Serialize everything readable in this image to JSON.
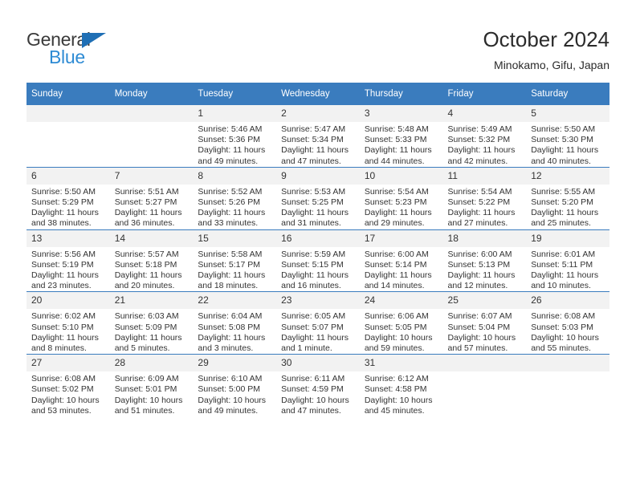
{
  "brand": {
    "name_part1": "General",
    "name_part2": "Blue",
    "triangle_color": "#1f6fb5",
    "blue_text_color": "#2e8bd4"
  },
  "header": {
    "title": "October 2024",
    "subtitle": "Minokamo, Gifu, Japan",
    "accent_color": "#3a7cbe"
  },
  "weekdays": [
    "Sunday",
    "Monday",
    "Tuesday",
    "Wednesday",
    "Thursday",
    "Friday",
    "Saturday"
  ],
  "weeks": [
    [
      {
        "day": "",
        "empty": true
      },
      {
        "day": "",
        "empty": true
      },
      {
        "day": "1",
        "sunrise": "Sunrise: 5:46 AM",
        "sunset": "Sunset: 5:36 PM",
        "daylight": "Daylight: 11 hours and 49 minutes."
      },
      {
        "day": "2",
        "sunrise": "Sunrise: 5:47 AM",
        "sunset": "Sunset: 5:34 PM",
        "daylight": "Daylight: 11 hours and 47 minutes."
      },
      {
        "day": "3",
        "sunrise": "Sunrise: 5:48 AM",
        "sunset": "Sunset: 5:33 PM",
        "daylight": "Daylight: 11 hours and 44 minutes."
      },
      {
        "day": "4",
        "sunrise": "Sunrise: 5:49 AM",
        "sunset": "Sunset: 5:32 PM",
        "daylight": "Daylight: 11 hours and 42 minutes."
      },
      {
        "day": "5",
        "sunrise": "Sunrise: 5:50 AM",
        "sunset": "Sunset: 5:30 PM",
        "daylight": "Daylight: 11 hours and 40 minutes."
      }
    ],
    [
      {
        "day": "6",
        "sunrise": "Sunrise: 5:50 AM",
        "sunset": "Sunset: 5:29 PM",
        "daylight": "Daylight: 11 hours and 38 minutes."
      },
      {
        "day": "7",
        "sunrise": "Sunrise: 5:51 AM",
        "sunset": "Sunset: 5:27 PM",
        "daylight": "Daylight: 11 hours and 36 minutes."
      },
      {
        "day": "8",
        "sunrise": "Sunrise: 5:52 AM",
        "sunset": "Sunset: 5:26 PM",
        "daylight": "Daylight: 11 hours and 33 minutes."
      },
      {
        "day": "9",
        "sunrise": "Sunrise: 5:53 AM",
        "sunset": "Sunset: 5:25 PM",
        "daylight": "Daylight: 11 hours and 31 minutes."
      },
      {
        "day": "10",
        "sunrise": "Sunrise: 5:54 AM",
        "sunset": "Sunset: 5:23 PM",
        "daylight": "Daylight: 11 hours and 29 minutes."
      },
      {
        "day": "11",
        "sunrise": "Sunrise: 5:54 AM",
        "sunset": "Sunset: 5:22 PM",
        "daylight": "Daylight: 11 hours and 27 minutes."
      },
      {
        "day": "12",
        "sunrise": "Sunrise: 5:55 AM",
        "sunset": "Sunset: 5:20 PM",
        "daylight": "Daylight: 11 hours and 25 minutes."
      }
    ],
    [
      {
        "day": "13",
        "sunrise": "Sunrise: 5:56 AM",
        "sunset": "Sunset: 5:19 PM",
        "daylight": "Daylight: 11 hours and 23 minutes."
      },
      {
        "day": "14",
        "sunrise": "Sunrise: 5:57 AM",
        "sunset": "Sunset: 5:18 PM",
        "daylight": "Daylight: 11 hours and 20 minutes."
      },
      {
        "day": "15",
        "sunrise": "Sunrise: 5:58 AM",
        "sunset": "Sunset: 5:17 PM",
        "daylight": "Daylight: 11 hours and 18 minutes."
      },
      {
        "day": "16",
        "sunrise": "Sunrise: 5:59 AM",
        "sunset": "Sunset: 5:15 PM",
        "daylight": "Daylight: 11 hours and 16 minutes."
      },
      {
        "day": "17",
        "sunrise": "Sunrise: 6:00 AM",
        "sunset": "Sunset: 5:14 PM",
        "daylight": "Daylight: 11 hours and 14 minutes."
      },
      {
        "day": "18",
        "sunrise": "Sunrise: 6:00 AM",
        "sunset": "Sunset: 5:13 PM",
        "daylight": "Daylight: 11 hours and 12 minutes."
      },
      {
        "day": "19",
        "sunrise": "Sunrise: 6:01 AM",
        "sunset": "Sunset: 5:11 PM",
        "daylight": "Daylight: 11 hours and 10 minutes."
      }
    ],
    [
      {
        "day": "20",
        "sunrise": "Sunrise: 6:02 AM",
        "sunset": "Sunset: 5:10 PM",
        "daylight": "Daylight: 11 hours and 8 minutes."
      },
      {
        "day": "21",
        "sunrise": "Sunrise: 6:03 AM",
        "sunset": "Sunset: 5:09 PM",
        "daylight": "Daylight: 11 hours and 5 minutes."
      },
      {
        "day": "22",
        "sunrise": "Sunrise: 6:04 AM",
        "sunset": "Sunset: 5:08 PM",
        "daylight": "Daylight: 11 hours and 3 minutes."
      },
      {
        "day": "23",
        "sunrise": "Sunrise: 6:05 AM",
        "sunset": "Sunset: 5:07 PM",
        "daylight": "Daylight: 11 hours and 1 minute."
      },
      {
        "day": "24",
        "sunrise": "Sunrise: 6:06 AM",
        "sunset": "Sunset: 5:05 PM",
        "daylight": "Daylight: 10 hours and 59 minutes."
      },
      {
        "day": "25",
        "sunrise": "Sunrise: 6:07 AM",
        "sunset": "Sunset: 5:04 PM",
        "daylight": "Daylight: 10 hours and 57 minutes."
      },
      {
        "day": "26",
        "sunrise": "Sunrise: 6:08 AM",
        "sunset": "Sunset: 5:03 PM",
        "daylight": "Daylight: 10 hours and 55 minutes."
      }
    ],
    [
      {
        "day": "27",
        "sunrise": "Sunrise: 6:08 AM",
        "sunset": "Sunset: 5:02 PM",
        "daylight": "Daylight: 10 hours and 53 minutes."
      },
      {
        "day": "28",
        "sunrise": "Sunrise: 6:09 AM",
        "sunset": "Sunset: 5:01 PM",
        "daylight": "Daylight: 10 hours and 51 minutes."
      },
      {
        "day": "29",
        "sunrise": "Sunrise: 6:10 AM",
        "sunset": "Sunset: 5:00 PM",
        "daylight": "Daylight: 10 hours and 49 minutes."
      },
      {
        "day": "30",
        "sunrise": "Sunrise: 6:11 AM",
        "sunset": "Sunset: 4:59 PM",
        "daylight": "Daylight: 10 hours and 47 minutes."
      },
      {
        "day": "31",
        "sunrise": "Sunrise: 6:12 AM",
        "sunset": "Sunset: 4:58 PM",
        "daylight": "Daylight: 10 hours and 45 minutes."
      },
      {
        "day": "",
        "empty": true
      },
      {
        "day": "",
        "empty": true
      }
    ]
  ]
}
